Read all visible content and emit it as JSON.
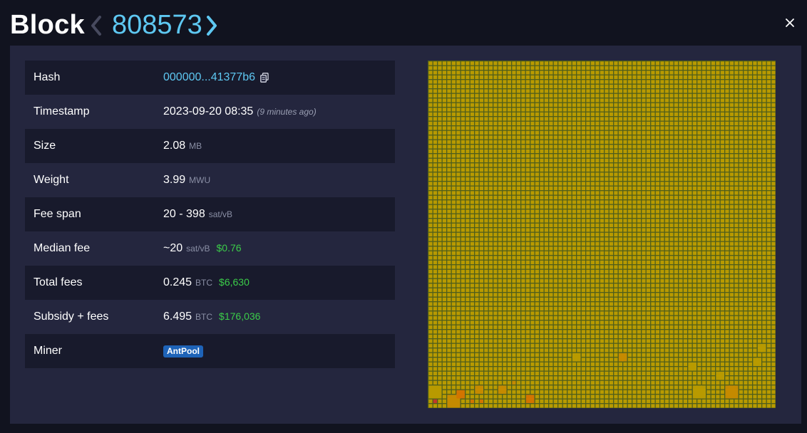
{
  "header": {
    "title": "Block",
    "block_number": "808573",
    "prev_icon": "chevron-left-icon",
    "next_icon": "chevron-right-icon",
    "close_icon": "close-icon",
    "prev_color": "#474a5e",
    "accent_color": "#5ec8f2"
  },
  "details": {
    "hash": {
      "label": "Hash",
      "value": "000000...41377b6",
      "copy_icon": "copy-icon"
    },
    "timestamp": {
      "label": "Timestamp",
      "value": "2023-09-20 08:35",
      "ago": "(9 minutes ago)"
    },
    "size": {
      "label": "Size",
      "value": "2.08",
      "unit": "MB"
    },
    "weight": {
      "label": "Weight",
      "value": "3.99",
      "unit": "MWU"
    },
    "fee_span": {
      "label": "Fee span",
      "value": "20 - 398",
      "unit": "sat/vB"
    },
    "median_fee": {
      "label": "Median fee",
      "value": "~20",
      "unit": "sat/vB",
      "usd": "$0.76"
    },
    "total_fees": {
      "label": "Total fees",
      "value": "0.245",
      "unit": "BTC",
      "usd": "$6,630"
    },
    "subsidy_fees": {
      "label": "Subsidy + fees",
      "value": "6.495",
      "unit": "BTC",
      "usd": "$176,036"
    },
    "miner": {
      "label": "Miner",
      "value": "AntPool"
    }
  },
  "block_visualization": {
    "icon": "transaction-blocks-grid",
    "colors": {
      "background": "#4f5e1c",
      "low_fee": "#b89a00",
      "mid_fee": "#c58a00",
      "high_fee": "#d27400",
      "highest_fee": "#c0392b"
    }
  }
}
